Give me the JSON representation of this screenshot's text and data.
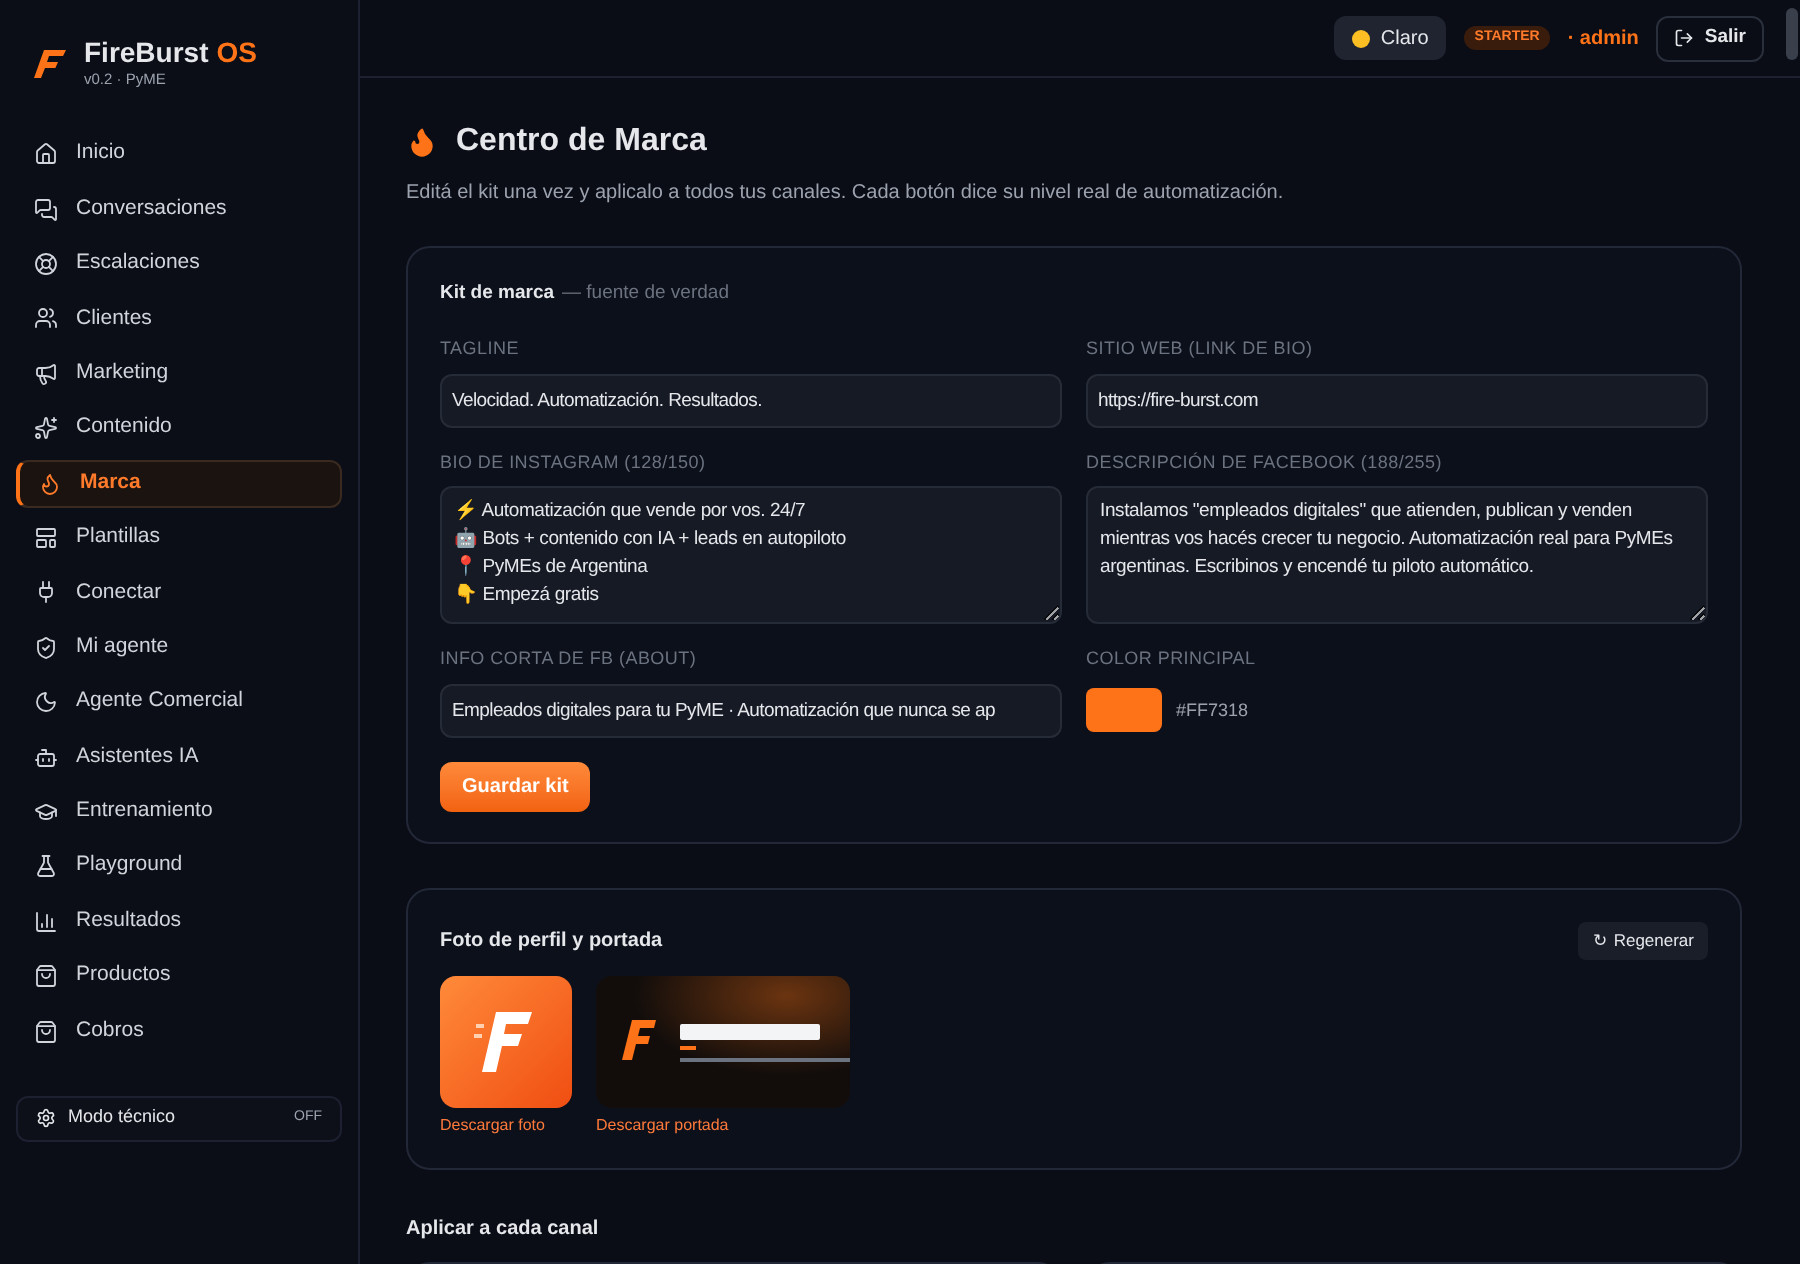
{
  "brand": {
    "name": "FireBurst",
    "suffix": "OS",
    "version": "v0.2 · PyME"
  },
  "sidebar": {
    "items": [
      {
        "label": "Inicio",
        "selected": false
      },
      {
        "label": "Conversaciones",
        "selected": false
      },
      {
        "label": "Escalaciones",
        "selected": false
      },
      {
        "label": "Clientes",
        "selected": false
      },
      {
        "label": "Marketing",
        "selected": false
      },
      {
        "label": "Contenido",
        "selected": false
      },
      {
        "label": "Marca",
        "selected": true
      },
      {
        "label": "Plantillas",
        "selected": false
      },
      {
        "label": "Conectar",
        "selected": false
      },
      {
        "label": "Mi agente",
        "selected": false
      },
      {
        "label": "Agente Comercial",
        "selected": false
      },
      {
        "label": "Asistentes IA",
        "selected": false
      },
      {
        "label": "Entrenamiento",
        "selected": false
      },
      {
        "label": "Playground",
        "selected": false
      },
      {
        "label": "Resultados",
        "selected": false
      },
      {
        "label": "Productos",
        "selected": false
      },
      {
        "label": "Cobros",
        "selected": false
      }
    ],
    "tech_mode": {
      "label": "Modo técnico",
      "state": "OFF",
      "on": false
    }
  },
  "topbar": {
    "theme_button": "Claro",
    "plan_badge": "STARTER",
    "user": "· admin",
    "logout": "Salir"
  },
  "page": {
    "title": "Centro de Marca",
    "subtitle": "Editá el kit una vez y aplicalo a todos tus canales. Cada botón dice su nivel real de automatización."
  },
  "kit": {
    "title": "Kit de marca",
    "note": "— fuente de verdad",
    "fields": [
      {
        "kind": "input",
        "label": "TAGLINE",
        "value": "Velocidad. Automatización. Resultados."
      },
      {
        "kind": "input",
        "label": "SITIO WEB (LINK DE BIO)",
        "value": "https://fire-burst.com"
      },
      {
        "kind": "textarea",
        "label": "BIO DE INSTAGRAM (128/150)",
        "value": "⚡ Automatización que vende por vos. 24/7\n🤖 Bots + contenido con IA + leads en autopiloto\n📍 PyMEs de Argentina\n👇 Empezá gratis"
      },
      {
        "kind": "textarea",
        "label": "DESCRIPCIÓN DE FACEBOOK (188/255)",
        "value": "Instalamos \"empleados digitales\" que atienden, publican y venden mientras vos hacés crecer tu negocio. Automatización real para PyMEs argentinas. Escribinos y encendé tu piloto automático."
      },
      {
        "kind": "input",
        "label": "INFO CORTA DE FB (ABOUT)",
        "value": "Empleados digitales para tu PyME · Automatización que nunca se ap"
      },
      {
        "kind": "color",
        "label": "COLOR PRINCIPAL",
        "value": "#FF7318",
        "color": "#ff7318"
      }
    ],
    "save_button": "Guardar kit"
  },
  "images": {
    "title": "Foto de perfil y portada",
    "regenerate": "↻ Regenerar",
    "items": [
      {
        "kind": "profile",
        "link": "Descargar foto"
      },
      {
        "kind": "cover",
        "link": "Descargar portada"
      }
    ]
  },
  "channels": {
    "title": "Aplicar a cada canal"
  }
}
